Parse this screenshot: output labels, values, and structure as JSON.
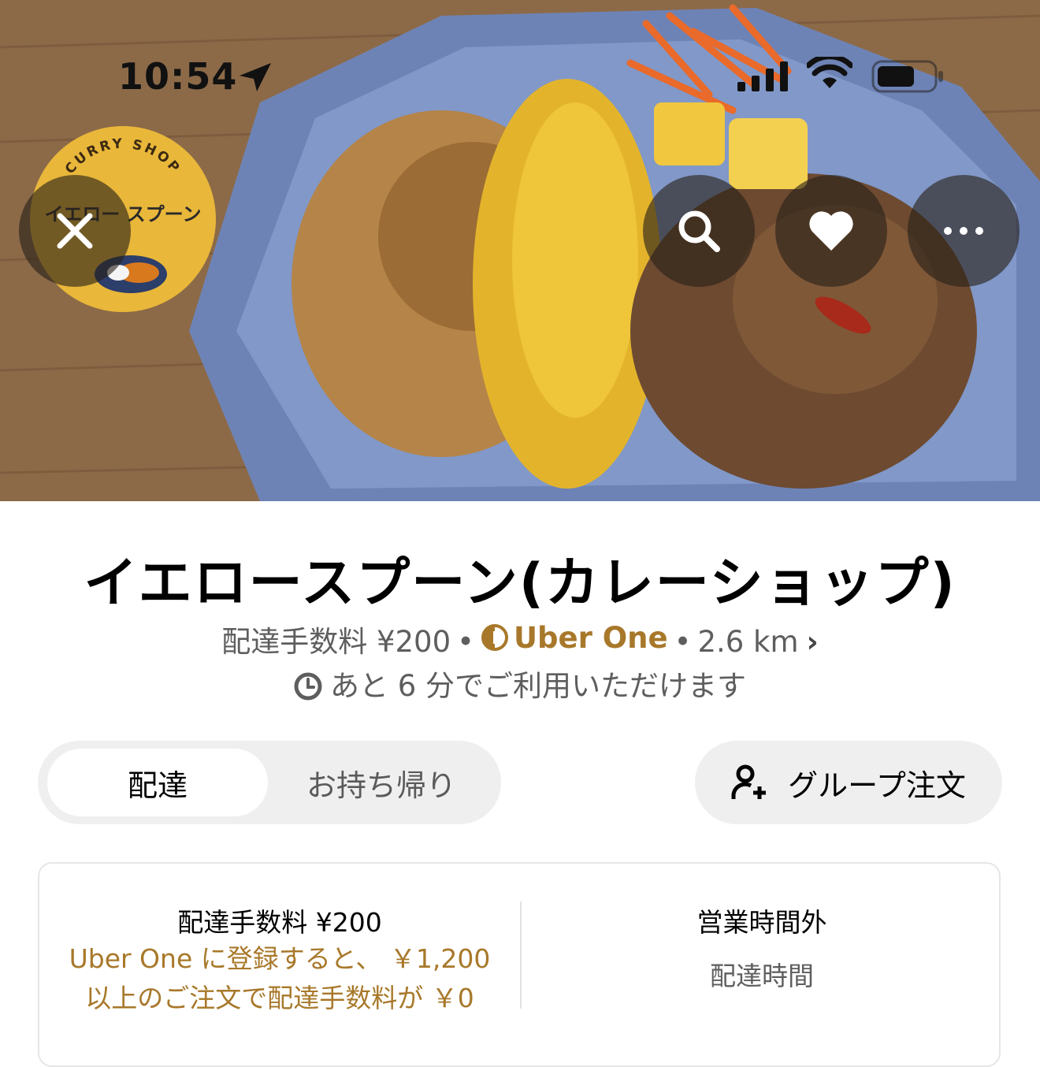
{
  "status_bar": {
    "time": "10:54",
    "icons": [
      "location-arrow-icon",
      "cellular-signal-icon",
      "wifi-icon",
      "battery-icon"
    ]
  },
  "hero": {
    "logo_text_top": "CURRY SHOP",
    "logo_text_main": "イエロー スプーン",
    "buttons": [
      "close-icon",
      "search-icon",
      "heart-icon",
      "more-icon"
    ]
  },
  "restaurant": {
    "name": "イエロースプーン(カレーショップ)",
    "delivery_fee_label": "配達手数料 ¥200",
    "uber_one": "Uber One",
    "distance": "2.6 km",
    "availability": "あと 6 分でご利用いただけます"
  },
  "mode_toggle": {
    "delivery": "配達",
    "pickup": "お持ち帰り",
    "selected": "配達"
  },
  "group_order": {
    "label": "グループ注文"
  },
  "info_card": {
    "fee_title": "配達手数料 ¥200",
    "fee_promo_line1": "Uber One に登録すると、 ￥1,200",
    "fee_promo_line2": "以上のご注文で配達手数料が ￥0",
    "hours_title": "営業時間外",
    "hours_sub": "配達時間"
  },
  "colors": {
    "uber_one_gold": "#a8782a",
    "pill_background": "#efefef",
    "secondary_text": "#5e5e5e",
    "logo_yellow": "#e9b73a"
  }
}
